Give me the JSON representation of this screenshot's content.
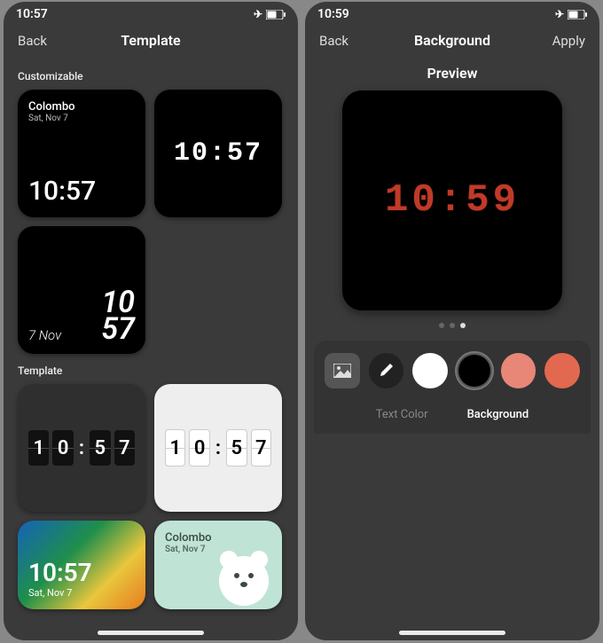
{
  "left": {
    "status_time": "10:57",
    "back": "Back",
    "title": "Template",
    "section_customizable": "Customizable",
    "section_template": "Template",
    "w1_city": "Colombo",
    "w1_date": "Sat, Nov 7",
    "w1_time": "10:57",
    "w2_time": "10:57",
    "w3_date": "7 Nov",
    "w3_hour": "10",
    "w3_min": "57",
    "flip_d1": "1",
    "flip_d2": "0",
    "flip_d3": "5",
    "flip_d4": "7",
    "w_color_time": "10:57",
    "w_color_date": "Sat, Nov 7",
    "w_bear_city": "Colombo",
    "w_bear_date": "Sat, Nov 7"
  },
  "right": {
    "status_time": "10:59",
    "back": "Back",
    "title": "Background",
    "apply": "Apply",
    "preview_label": "Preview",
    "preview_time": "10:59",
    "tab_text": "Text Color",
    "tab_bg": "Background",
    "image_icon": "image-icon",
    "picker_icon": "eyedropper-icon",
    "colors": {
      "white": "#ffffff",
      "black": "#000000",
      "salmon": "#e88778",
      "coral": "#e26850"
    }
  }
}
